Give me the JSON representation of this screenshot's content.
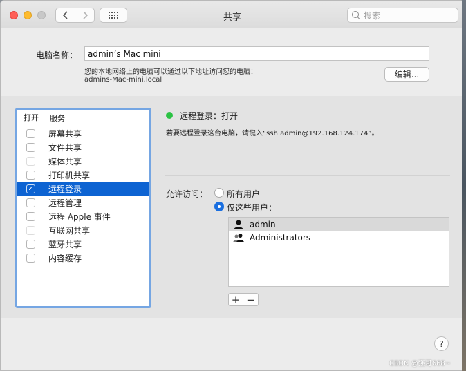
{
  "window": {
    "title": "共享",
    "search_placeholder": "搜索",
    "back_icon": "chevron-left-icon",
    "forward_icon": "chevron-right-icon"
  },
  "computer": {
    "name_label": "电脑名称：",
    "name_value": "admin’s Mac mini",
    "address_note": "您的本地网络上的电脑可以通过以下地址访问您的电脑：",
    "address": "admins-Mac-mini.local",
    "edit_label": "编辑..."
  },
  "services": {
    "header_on": "打开",
    "header_service": "服务",
    "items": [
      {
        "label": "屏幕共享",
        "checked": false
      },
      {
        "label": "文件共享",
        "checked": false
      },
      {
        "label": "媒体共享",
        "checked": false
      },
      {
        "label": "打印机共享",
        "checked": false
      },
      {
        "label": "远程登录",
        "checked": true
      },
      {
        "label": "远程管理",
        "checked": false
      },
      {
        "label": "远程 Apple 事件",
        "checked": false
      },
      {
        "label": "互联网共享",
        "checked": false
      },
      {
        "label": "蓝牙共享",
        "checked": false
      },
      {
        "label": "内容缓存",
        "checked": false
      }
    ]
  },
  "detail": {
    "status": "远程登录：打开",
    "status_color": "#2bc244",
    "description": "若要远程登录这台电脑，请键入“ssh admin@192.168.124.174”。",
    "allow_label": "允许访问：",
    "option_all": "所有用户",
    "option_these": "仅这些用户：",
    "selected_option": "these",
    "users": [
      {
        "name": "admin",
        "icon": "user-icon"
      },
      {
        "name": "Administrators",
        "icon": "group-icon"
      }
    ],
    "add_label": "+",
    "remove_label": "−"
  },
  "help_label": "?",
  "watermark": "CSDN @强哥668~",
  "accent_color": "#0d63d2"
}
